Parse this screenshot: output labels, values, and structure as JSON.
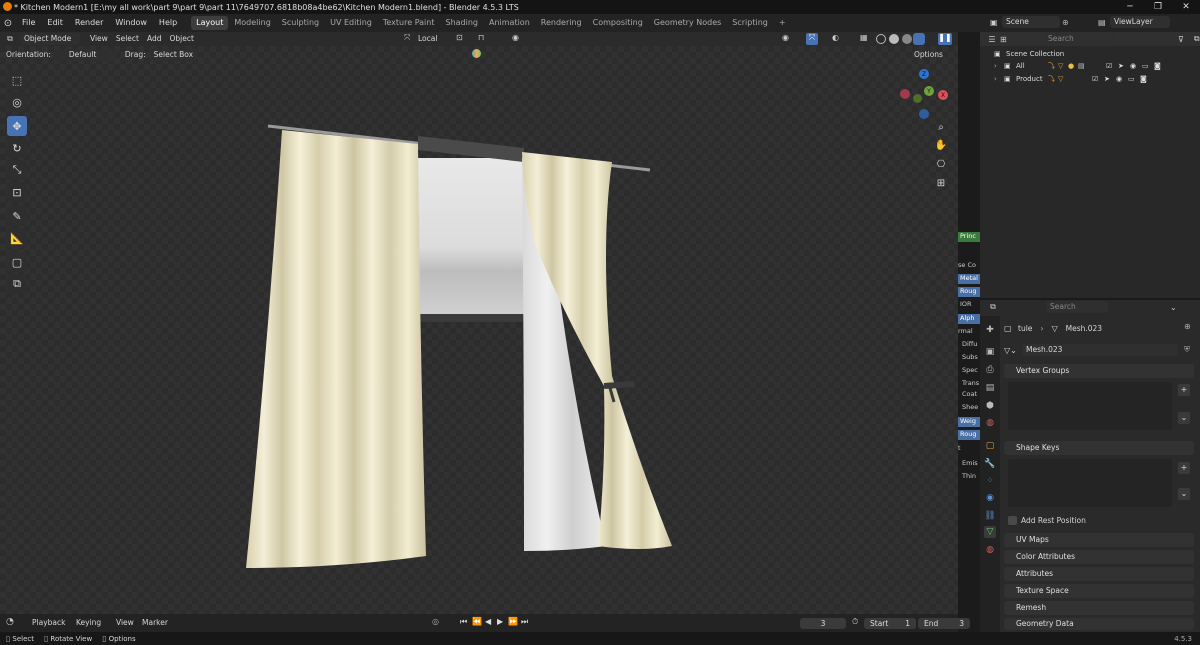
{
  "window": {
    "title": "* Kitchen Modern1 [E:\\my all work\\part 9\\part 9\\part 11\\7649707.6818b08a4be62\\Kitchen Modern1.blend] - Blender 4.5.3 LTS"
  },
  "menu": [
    "File",
    "Edit",
    "Render",
    "Window",
    "Help"
  ],
  "workspaces": [
    "Layout",
    "Modeling",
    "Sculpting",
    "UV Editing",
    "Texture Paint",
    "Shading",
    "Animation",
    "Rendering",
    "Compositing",
    "Geometry Nodes",
    "Scripting"
  ],
  "workspace_add": "+",
  "scene": {
    "name": "Scene",
    "view_layer": "ViewLayer"
  },
  "viewport_header": {
    "mode": "Object Mode",
    "menus": [
      "View",
      "Select",
      "Add",
      "Object"
    ],
    "transform_orientation": "Local",
    "orientation_label": "Orientation:",
    "orientation_value": "Default",
    "drag_label": "Drag:",
    "drag_value": "Select Box",
    "options": "Options"
  },
  "node_peek": [
    "Princ",
    "se Co",
    "Metal",
    "Roug",
    "IOR",
    "Alph",
    "rmal",
    "Diffu",
    "Subs",
    "Spec",
    "Trans",
    "Coat",
    "Shee",
    "Weig",
    "Roug",
    "t",
    "Emis",
    "Thin"
  ],
  "outliner": {
    "search_placeholder": "Search",
    "collection": "Scene Collection",
    "items": [
      "All",
      "Product"
    ]
  },
  "properties": {
    "search_placeholder": "Search",
    "object": "tule",
    "mesh": "Mesh.023",
    "mesh_field": "Mesh.023",
    "sections": {
      "vertex_groups": "Vertex Groups",
      "shape_keys": "Shape Keys",
      "add_rest_position": "Add Rest Position",
      "uv_maps": "UV Maps",
      "color_attributes": "Color Attributes",
      "attributes": "Attributes",
      "texture_space": "Texture Space",
      "remesh": "Remesh",
      "geometry_data": "Geometry Data"
    }
  },
  "timeline": {
    "menus": [
      "Playback",
      "Keying",
      "View",
      "Marker"
    ],
    "current_frame": "3",
    "start_label": "Start",
    "start_value": "1",
    "end_label": "End",
    "end_value": "3"
  },
  "statusbar": {
    "select": "Select",
    "rotate": "Rotate View",
    "options": "Options",
    "version": "4.5.3"
  },
  "colors": {
    "accent": "#4772b3",
    "viewport_bg": "#2c2c2c",
    "curtain": "#f0ead0"
  }
}
